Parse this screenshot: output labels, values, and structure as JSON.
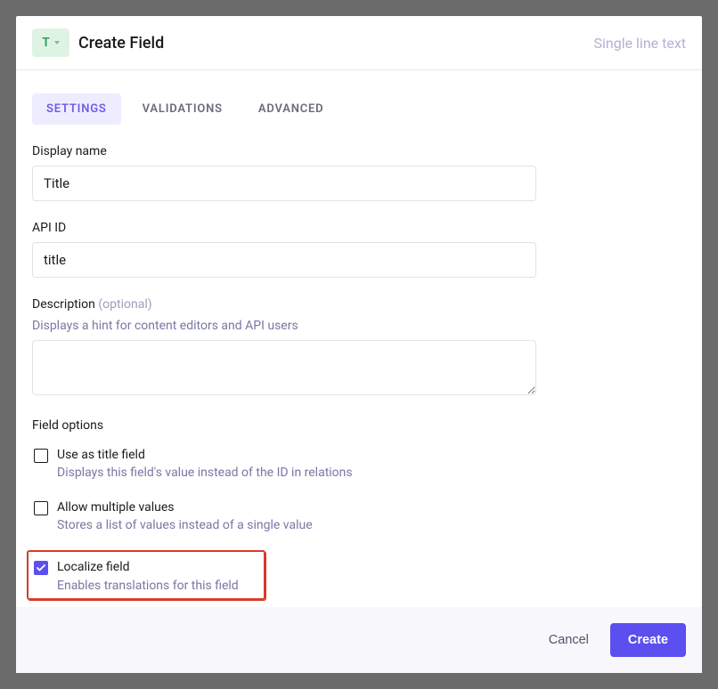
{
  "header": {
    "badge_letter": "T",
    "title": "Create Field",
    "field_type": "Single line text"
  },
  "tabs": [
    {
      "label": "SETTINGS",
      "active": true
    },
    {
      "label": "VALIDATIONS",
      "active": false
    },
    {
      "label": "ADVANCED",
      "active": false
    }
  ],
  "form": {
    "display_name": {
      "label": "Display name",
      "value": "Title"
    },
    "api_id": {
      "label": "API ID",
      "value": "title"
    },
    "description": {
      "label": "Description",
      "optional": "(optional)",
      "hint": "Displays a hint for content editors and API users",
      "value": ""
    }
  },
  "field_options": {
    "title": "Field options",
    "items": [
      {
        "label": "Use as title field",
        "hint": "Displays this field's value instead of the ID in relations",
        "checked": false
      },
      {
        "label": "Allow multiple values",
        "hint": "Stores a list of values instead of a single value",
        "checked": false
      },
      {
        "label": "Localize field",
        "hint": "Enables translations for this field",
        "checked": true,
        "highlighted": true
      }
    ]
  },
  "footer": {
    "cancel": "Cancel",
    "create": "Create"
  }
}
